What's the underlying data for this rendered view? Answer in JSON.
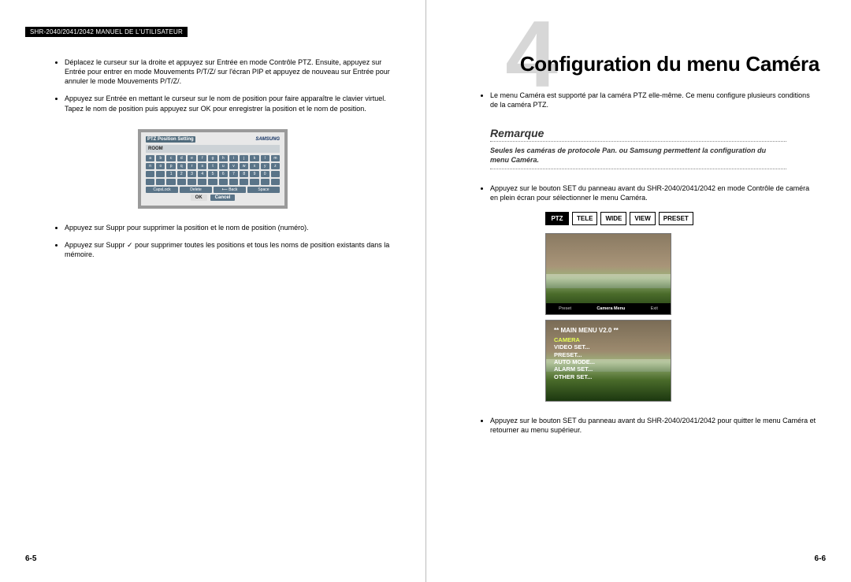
{
  "left": {
    "running_head": "SHR-2040/2041/2042 MANUEL DE L'UTILISATEUR",
    "bullets_top": [
      "Déplacez le curseur sur la droite et appuyez sur Entrée en mode Contrôle PTZ. Ensuite, appuyez sur Entrée pour entrer en mode Mouvements P/T/Z/ sur l'écran PIP et appuyez de nouveau sur Entrée pour annuler le mode Mouvements P/T/Z/.",
      "Appuyez sur Entrée en mettant le curseur sur le nom de position pour faire apparaître le clavier virtuel. Tapez le nom de position puis appuyez sur OK pour enregistrer la position et le nom de position."
    ],
    "ptz": {
      "title": "PTZ Position Setting",
      "logo": "SAMSUNG",
      "field": "ROOM",
      "rows": [
        [
          "a",
          "b",
          "c",
          "d",
          "e",
          "f",
          "g",
          "h",
          "i",
          "j",
          "k",
          "l",
          "m"
        ],
        [
          "n",
          "o",
          "p",
          "q",
          "r",
          "s",
          "t",
          "u",
          "v",
          "w",
          "x",
          "y",
          "z"
        ],
        [
          "",
          "",
          "1",
          "2",
          "3",
          "4",
          "5",
          "6",
          "7",
          "8",
          "9",
          "0",
          ""
        ],
        [
          "",
          "",
          "",
          "",
          "",
          "",
          "",
          "",
          "",
          "",
          "",
          "",
          ""
        ]
      ],
      "fn": [
        "CapsLock",
        "Delete",
        "⟵ Back",
        "Space"
      ],
      "ok": "OK",
      "cancel": "Cancel"
    },
    "bullets_bottom": [
      "Appuyez sur Suppr pour supprimer la position et le nom de position (numéro).",
      "Appuyez sur Suppr ✓ pour supprimer toutes les positions et tous les noms de position existants dans la mémoire."
    ],
    "pagenum": "6-5"
  },
  "right": {
    "chapter_number": "4",
    "chapter_title": "Configuration du menu Caméra",
    "intro_bullet": "Le menu Caméra est supporté par la caméra PTZ elle-même. Ce menu configure plusieurs conditions de la caméra PTZ.",
    "remark_head": "Remarque",
    "remark_body": "Seules les caméras de protocole Pan. ou Samsung permettent la configuration du menu Caméra.",
    "set_bullet": "Appuyez sur le bouton SET du panneau avant du SHR-2040/2041/2042 en mode Contrôle de caméra en plein écran pour sélectionner le menu Caméra.",
    "modes": [
      "PTZ",
      "TELE",
      "WIDE",
      "VIEW",
      "PRESET"
    ],
    "cam_bar": {
      "left": "Preset",
      "mid": "Camera Menu",
      "right": "Exit"
    },
    "menu": {
      "title": "** MAIN MENU V2.0 **",
      "items": [
        "CAMERA",
        "VIDEO SET...",
        "PRESET...",
        "AUTO MODE...",
        "ALARM SET...",
        "OTHER SET..."
      ]
    },
    "quit_bullet": "Appuyez sur le bouton SET du panneau avant du SHR-2040/2041/2042 pour quitter le menu Caméra et retourner au menu supérieur.",
    "pagenum": "6-6"
  }
}
